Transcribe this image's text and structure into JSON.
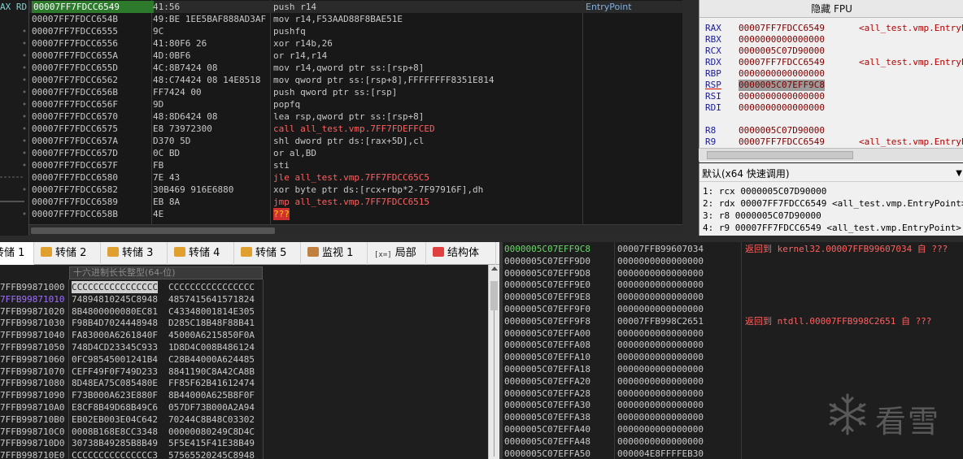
{
  "left_strip": {
    "header": "AX RD"
  },
  "disassembly": {
    "entry_label": "EntryPoint",
    "rows": [
      {
        "addr": "00007FF7FDCC6549",
        "bytes": "41:56",
        "instr": "push r14",
        "style": "normal",
        "selected": true
      },
      {
        "addr": "00007FF7FDCC654B",
        "bytes": "49:BE 1EE5BAF888AD3AF",
        "instr": "mov r14,F53AAD88F8BAE51E",
        "style": "normal"
      },
      {
        "addr": "00007FF7FDCC6555",
        "bytes": "9C",
        "instr": "pushfq",
        "style": "normal"
      },
      {
        "addr": "00007FF7FDCC6556",
        "bytes": "41:80F6 26",
        "instr": "xor r14b,26",
        "style": "normal"
      },
      {
        "addr": "00007FF7FDCC655A",
        "bytes": "4D:0BF6",
        "instr": "or r14,r14",
        "style": "normal"
      },
      {
        "addr": "00007FF7FDCC655D",
        "bytes": "4C:8B7424 08",
        "instr": "mov r14,qword ptr ss:[rsp+8]",
        "style": "normal"
      },
      {
        "addr": "00007FF7FDCC6562",
        "bytes": "48:C74424 08 14E8518",
        "instr": "mov qword ptr ss:[rsp+8],FFFFFFFF8351E814",
        "style": "normal"
      },
      {
        "addr": "00007FF7FDCC656B",
        "bytes": "FF7424 00",
        "instr": "push qword ptr ss:[rsp]",
        "style": "normal"
      },
      {
        "addr": "00007FF7FDCC656F",
        "bytes": "9D",
        "instr": "popfq",
        "style": "normal"
      },
      {
        "addr": "00007FF7FDCC6570",
        "bytes": "48:8D6424 08",
        "instr": "lea rsp,qword ptr ss:[rsp+8]",
        "style": "normal"
      },
      {
        "addr": "00007FF7FDCC6575",
        "bytes": "E8 73972300",
        "instr": "call all_test.vmp.7FF7FDEFFCED",
        "style": "red"
      },
      {
        "addr": "00007FF7FDCC657A",
        "bytes": "D370 5D",
        "instr": "shl dword ptr ds:[rax+5D],cl",
        "style": "normal"
      },
      {
        "addr": "00007FF7FDCC657D",
        "bytes": "0C BD",
        "instr": "or al,BD",
        "style": "normal"
      },
      {
        "addr": "00007FF7FDCC657F",
        "bytes": "FB",
        "instr": "sti",
        "style": "normal"
      },
      {
        "addr": "00007FF7FDCC6580",
        "bytes": "7E 43",
        "instr": "jle all_test.vmp.7FF7FDCC65C5",
        "style": "red"
      },
      {
        "addr": "00007FF7FDCC6582",
        "bytes": "30B469 916E6880",
        "instr": "xor byte ptr ds:[rcx+rbp*2-7F97916F],dh",
        "style": "normal"
      },
      {
        "addr": "00007FF7FDCC6589",
        "bytes": "EB 8A",
        "instr": "jmp all_test.vmp.7FF7FDCC6515",
        "style": "red"
      },
      {
        "addr": "00007FF7FDCC658B",
        "bytes": "4E",
        "instr": "???",
        "style": "bad"
      }
    ]
  },
  "registers": {
    "hide_fpu_label": "隐藏 FPU",
    "rows": [
      {
        "name": "RAX",
        "value": "00007FF7FDCC6549",
        "symbol": "<all_test.vmp.EntryPoint>"
      },
      {
        "name": "RBX",
        "value": "0000000000000000",
        "symbol": ""
      },
      {
        "name": "RCX",
        "value": "0000005C07D90000",
        "symbol": ""
      },
      {
        "name": "RDX",
        "value": "00007FF7FDCC6549",
        "symbol": "<all_test.vmp.EntryPoint>"
      },
      {
        "name": "RBP",
        "value": "0000000000000000",
        "symbol": ""
      },
      {
        "name": "RSP",
        "value": "0000005C07EFF9C8",
        "symbol": "",
        "highlight": true
      },
      {
        "name": "RSI",
        "value": "0000000000000000",
        "symbol": ""
      },
      {
        "name": "RDI",
        "value": "0000000000000000",
        "symbol": ""
      },
      {
        "name": "",
        "value": "",
        "symbol": ""
      },
      {
        "name": "R8",
        "value": "0000005C07D90000",
        "symbol": ""
      },
      {
        "name": "R9",
        "value": "00007FF7FDCC6549",
        "symbol": "<all_test.vmp.EntryPoint>"
      }
    ]
  },
  "call_convention": {
    "selected": "默认(x64 快速调用)",
    "args": [
      "1: rcx 0000005C07D90000",
      "2: rdx 00007FF7FDCC6549 <all_test.vmp.EntryPoint>",
      "3: r8 0000005C07D90000",
      "4: r9 00007FF7FDCC6549 <all_test.vmp.EntryPoint>"
    ]
  },
  "dump_tabs": [
    {
      "label": "转储 1",
      "active": true,
      "icon_color": "#5aa0e0"
    },
    {
      "label": "转储 2",
      "active": false,
      "icon_color": "#e0a030"
    },
    {
      "label": "转储 3",
      "active": false,
      "icon_color": "#e0a030"
    },
    {
      "label": "转储 4",
      "active": false,
      "icon_color": "#e0a030"
    },
    {
      "label": "转储 5",
      "active": false,
      "icon_color": "#e0a030"
    },
    {
      "label": "监视 1",
      "active": false,
      "icon_color": "#c08040"
    },
    {
      "label": "局部",
      "active": false,
      "icon_glyph": "[x=]"
    },
    {
      "label": "结构体",
      "active": false,
      "icon_color": "#e04040"
    }
  ],
  "dump": {
    "column_header": "十六进制长长整型(64-位)",
    "rows": [
      {
        "addr": "7FFB99871000",
        "q1": "CCCCCCCCCCCCCCCC",
        "q2": "CCCCCCCCCCCCCCCC",
        "q1_selected": true
      },
      {
        "addr": "7FFB99871010",
        "q1": "74894810245C8948",
        "q2": "4857415641571824",
        "addr_highlight": true
      },
      {
        "addr": "7FFB99871020",
        "q1": "8B4800000080EC81",
        "q2": "C43348001814E305"
      },
      {
        "addr": "7FFB99871030",
        "q1": "F98B4D7024448948",
        "q2": "D285C18B48F88B41"
      },
      {
        "addr": "7FFB99871040",
        "q1": "FA83000A6261840F",
        "q2": "45000A6215850F0A"
      },
      {
        "addr": "7FFB99871050",
        "q1": "748D4CD23345C933",
        "q2": "1D8D4C008B486124"
      },
      {
        "addr": "7FFB99871060",
        "q1": "0FC98545001241B4",
        "q2": "C28B44000A624485"
      },
      {
        "addr": "7FFB99871070",
        "q1": "CEFF49F0F749D233",
        "q2": "8841190C8A42CA8B"
      },
      {
        "addr": "7FFB99871080",
        "q1": "8D48EA75C085480E",
        "q2": "FF85F62B41612474"
      },
      {
        "addr": "7FFB99871090",
        "q1": "F73B000A623E880F",
        "q2": "8B44000A625B8F0F"
      },
      {
        "addr": "7FFB998710A0",
        "q1": "E8CF8B49D68B49C6",
        "q2": "057DF73B000A2A94"
      },
      {
        "addr": "7FFB998710B0",
        "q1": "EB02EB003E04C642",
        "q2": "70244C8B48C03302"
      },
      {
        "addr": "7FFB998710C0",
        "q1": "0008B168E8CC3348",
        "q2": "00000080249C8D4C"
      },
      {
        "addr": "7FFB998710D0",
        "q1": "30738B49285B8B49",
        "q2": "5F5E415F41E38B49"
      },
      {
        "addr": "7FFB998710E0",
        "q1": "CCCCCCCCCCCCCCC3",
        "q2": "57565520245C8948"
      }
    ]
  },
  "stack": {
    "rows": [
      {
        "addr": "0000005C07EFF9C8",
        "value": "00007FFB99607034",
        "comment": "返回到 kernel32.00007FFB99607034 自 ???",
        "selected": true
      },
      {
        "addr": "0000005C07EFF9D0",
        "value": "0000000000000000",
        "comment": ""
      },
      {
        "addr": "0000005C07EFF9D8",
        "value": "0000000000000000",
        "comment": ""
      },
      {
        "addr": "0000005C07EFF9E0",
        "value": "0000000000000000",
        "comment": ""
      },
      {
        "addr": "0000005C07EFF9E8",
        "value": "0000000000000000",
        "comment": ""
      },
      {
        "addr": "0000005C07EFF9F0",
        "value": "0000000000000000",
        "comment": ""
      },
      {
        "addr": "0000005C07EFF9F8",
        "value": "00007FFB998C2651",
        "comment": "返回到 ntdll.00007FFB998C2651 自 ???"
      },
      {
        "addr": "0000005C07EFFA00",
        "value": "0000000000000000",
        "comment": ""
      },
      {
        "addr": "0000005C07EFFA08",
        "value": "0000000000000000",
        "comment": ""
      },
      {
        "addr": "0000005C07EFFA10",
        "value": "0000000000000000",
        "comment": ""
      },
      {
        "addr": "0000005C07EFFA18",
        "value": "0000000000000000",
        "comment": ""
      },
      {
        "addr": "0000005C07EFFA20",
        "value": "0000000000000000",
        "comment": ""
      },
      {
        "addr": "0000005C07EFFA28",
        "value": "0000000000000000",
        "comment": ""
      },
      {
        "addr": "0000005C07EFFA30",
        "value": "0000000000000000",
        "comment": ""
      },
      {
        "addr": "0000005C07EFFA38",
        "value": "0000000000000000",
        "comment": ""
      },
      {
        "addr": "0000005C07EFFA40",
        "value": "0000000000000000",
        "comment": ""
      },
      {
        "addr": "0000005C07EFFA48",
        "value": "0000000000000000",
        "comment": ""
      },
      {
        "addr": "0000005C07EFFA50",
        "value": "000004E8FFFFEB30",
        "comment": ""
      }
    ]
  },
  "watermark": {
    "text": "看雪"
  }
}
